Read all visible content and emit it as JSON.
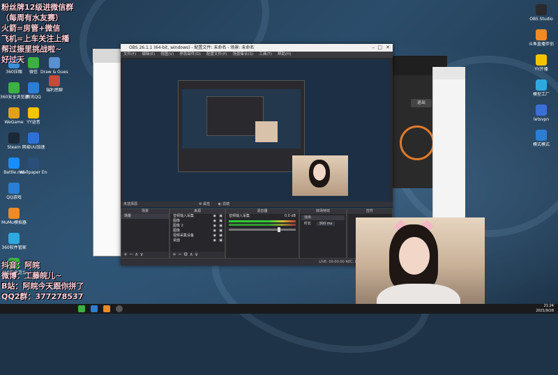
{
  "overlay": {
    "top_lines": [
      "粉丝牌12级进微信群",
      "（每周有水友赛）",
      "火箭=房管+微信",
      "飞机=上车关注上播",
      "帮过振里挑战啦~",
      "好过天"
    ],
    "bottom_lines": [
      "抖音：阿皖",
      "微博：工藤皖儿~",
      "B站：阿皖今天跟你拼了",
      "QQ2群：377278537"
    ]
  },
  "desktop_icons_left": [
    {
      "label": "360压缩",
      "color": "#3a8fd8"
    },
    {
      "label": "360安全浏览器",
      "color": "#3cb043"
    },
    {
      "label": "WeGame",
      "color": "#e0a020"
    },
    {
      "label": "Steam",
      "color": "#1b2838"
    },
    {
      "label": "Battle.net",
      "color": "#1a8cff"
    },
    {
      "label": "QQ游戏",
      "color": "#2a7fd4"
    },
    {
      "label": "MuMu模拟器",
      "color": "#f08a24"
    },
    {
      "label": "360软件管家",
      "color": "#2fa8e0"
    },
    {
      "label": "360安全卫士",
      "color": "#3cb043"
    }
  ],
  "desktop_icons_col2": [
    {
      "label": "微信",
      "color": "#3cb043"
    },
    {
      "label": "腾讯QQ",
      "color": "#2a7fd4"
    },
    {
      "label": "YY语音",
      "color": "#f5c400"
    },
    {
      "label": "网易UU加速",
      "color": "#2f6fd8"
    },
    {
      "label": "Wallpaper Engine",
      "color": "#2b4f7a"
    }
  ],
  "desktop_icons_col3": [
    {
      "label": "Draw & Guess",
      "color": "#5a8fd0"
    },
    {
      "label": "瑞利思聊",
      "color": "#c74a3a"
    }
  ],
  "desktop_icons_right": [
    {
      "label": "OBS Studio",
      "color": "#2a2a2e"
    },
    {
      "label": "斗鱼直播伴侣",
      "color": "#f08a24"
    },
    {
      "label": "YY开播",
      "color": "#f5c400"
    },
    {
      "label": "模型工厂",
      "color": "#2fa8e0"
    },
    {
      "label": "letsvpn",
      "color": "#3a6fd8"
    },
    {
      "label": "模式模式",
      "color": "#2a7fd4"
    }
  ],
  "obs": {
    "title": "OBS 26.1.1 (64-bit, windows) - 配置文件: 未命名 - 场景: 未命名",
    "menu": [
      "文件(F)",
      "编辑(E)",
      "视图(V)",
      "停靠部件(D)",
      "配置文件(P)",
      "场景集合(S)",
      "工具(T)",
      "帮助(H)"
    ],
    "scene_bar_label": "未选择源",
    "scene_bar_props": "属性",
    "scene_bar_filters": "滤镜",
    "docks": {
      "scenes": {
        "title": "场景",
        "items": [
          "场景"
        ]
      },
      "sources": {
        "title": "来源",
        "items": [
          "音频输入采集",
          "图像",
          "图像 2",
          "图像",
          "视频采集设备",
          "桌面"
        ]
      },
      "mixer": {
        "title": "混音器",
        "channel": "音频输入采集",
        "db": "0.0 dB"
      },
      "transitions": {
        "title": "转场特效",
        "type": "淡出",
        "duration_label": "时长",
        "duration": "300 ms"
      },
      "controls": {
        "title": "控件"
      }
    },
    "status": "LIVE: 00:00:00   REC: 00:00:00   CPU: 2.1%"
  },
  "right_panel": {
    "button_label": "退出"
  },
  "clock": {
    "time": "21:24",
    "date": "2021/9/28"
  }
}
